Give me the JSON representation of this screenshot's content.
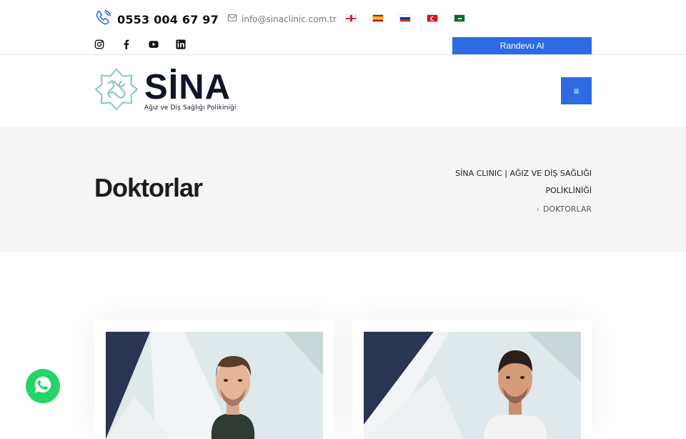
{
  "topbar": {
    "phone": "0553 004 67 97",
    "email": "info@sinaclinic.com.tr",
    "languages": [
      {
        "code": "en",
        "icon": "english-flag-icon"
      },
      {
        "code": "es",
        "icon": "spanish-flag-icon"
      },
      {
        "code": "ru",
        "icon": "russian-flag-icon"
      },
      {
        "code": "tr",
        "icon": "turkish-flag-icon"
      },
      {
        "code": "ar",
        "icon": "saudi-flag-icon"
      }
    ],
    "socials": [
      "instagram-icon",
      "facebook-icon",
      "youtube-icon",
      "linkedin-icon"
    ],
    "appointment_label": "Randevu Al"
  },
  "header": {
    "logo_name": "SİNA",
    "logo_tagline": "Ağız ve Diş Sağlığı Polikiniği",
    "menu_icon": "≡"
  },
  "page_title": {
    "title": "Doktorlar",
    "breadcrumb_home": "SİNA CLINIC | AĞIZ VE DİŞ SAĞLIĞI POLİKLİNİĞİ",
    "breadcrumb_current": "DOKTORLAR"
  },
  "colors": {
    "accent": "#2d6ae3",
    "navy": "#101628",
    "band": "#f5f5f5",
    "whatsapp": "#25d366"
  },
  "doctor_cards": [
    {
      "photo": "doctor-photo"
    },
    {
      "photo": "doctor-photo"
    }
  ]
}
